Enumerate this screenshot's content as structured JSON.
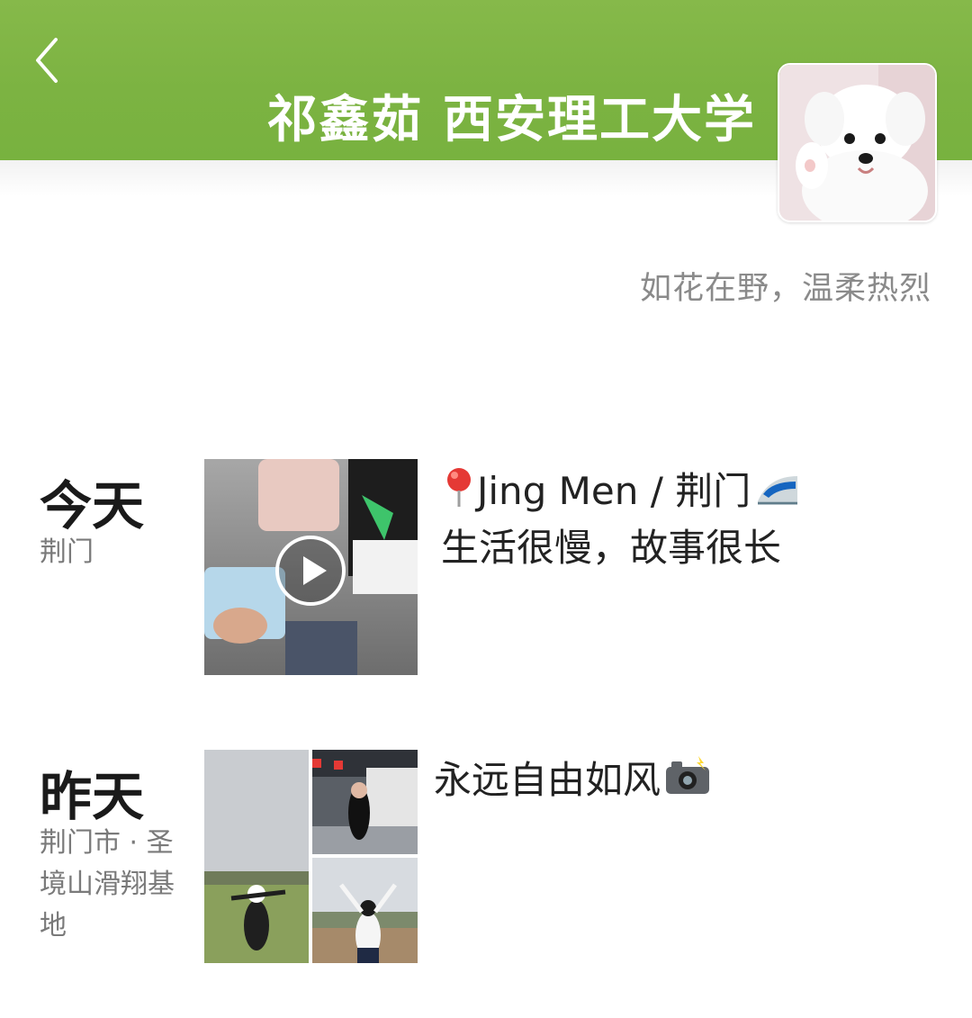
{
  "profile": {
    "name": "祁鑫茹 西安理工大学",
    "signature": "如花在野，温柔热烈"
  },
  "posts": [
    {
      "day": "今天",
      "location": "荆门",
      "line1": "Jing Men / 荆门",
      "line2": "生活很慢，故事很长",
      "media": "video"
    },
    {
      "day": "昨天",
      "location": "荆门市 · 圣境山滑翔基地",
      "text": "永远自由如风",
      "media": "photos-3"
    }
  ],
  "icons": {
    "back": "chevron-left-icon",
    "pin": "pin-icon",
    "train": "bullet-train-icon",
    "camera": "camera-flash-icon",
    "play": "play-icon"
  },
  "colors": {
    "header": "#7cb342",
    "signature": "#8a8a8a",
    "location": "#7a7a7a"
  }
}
